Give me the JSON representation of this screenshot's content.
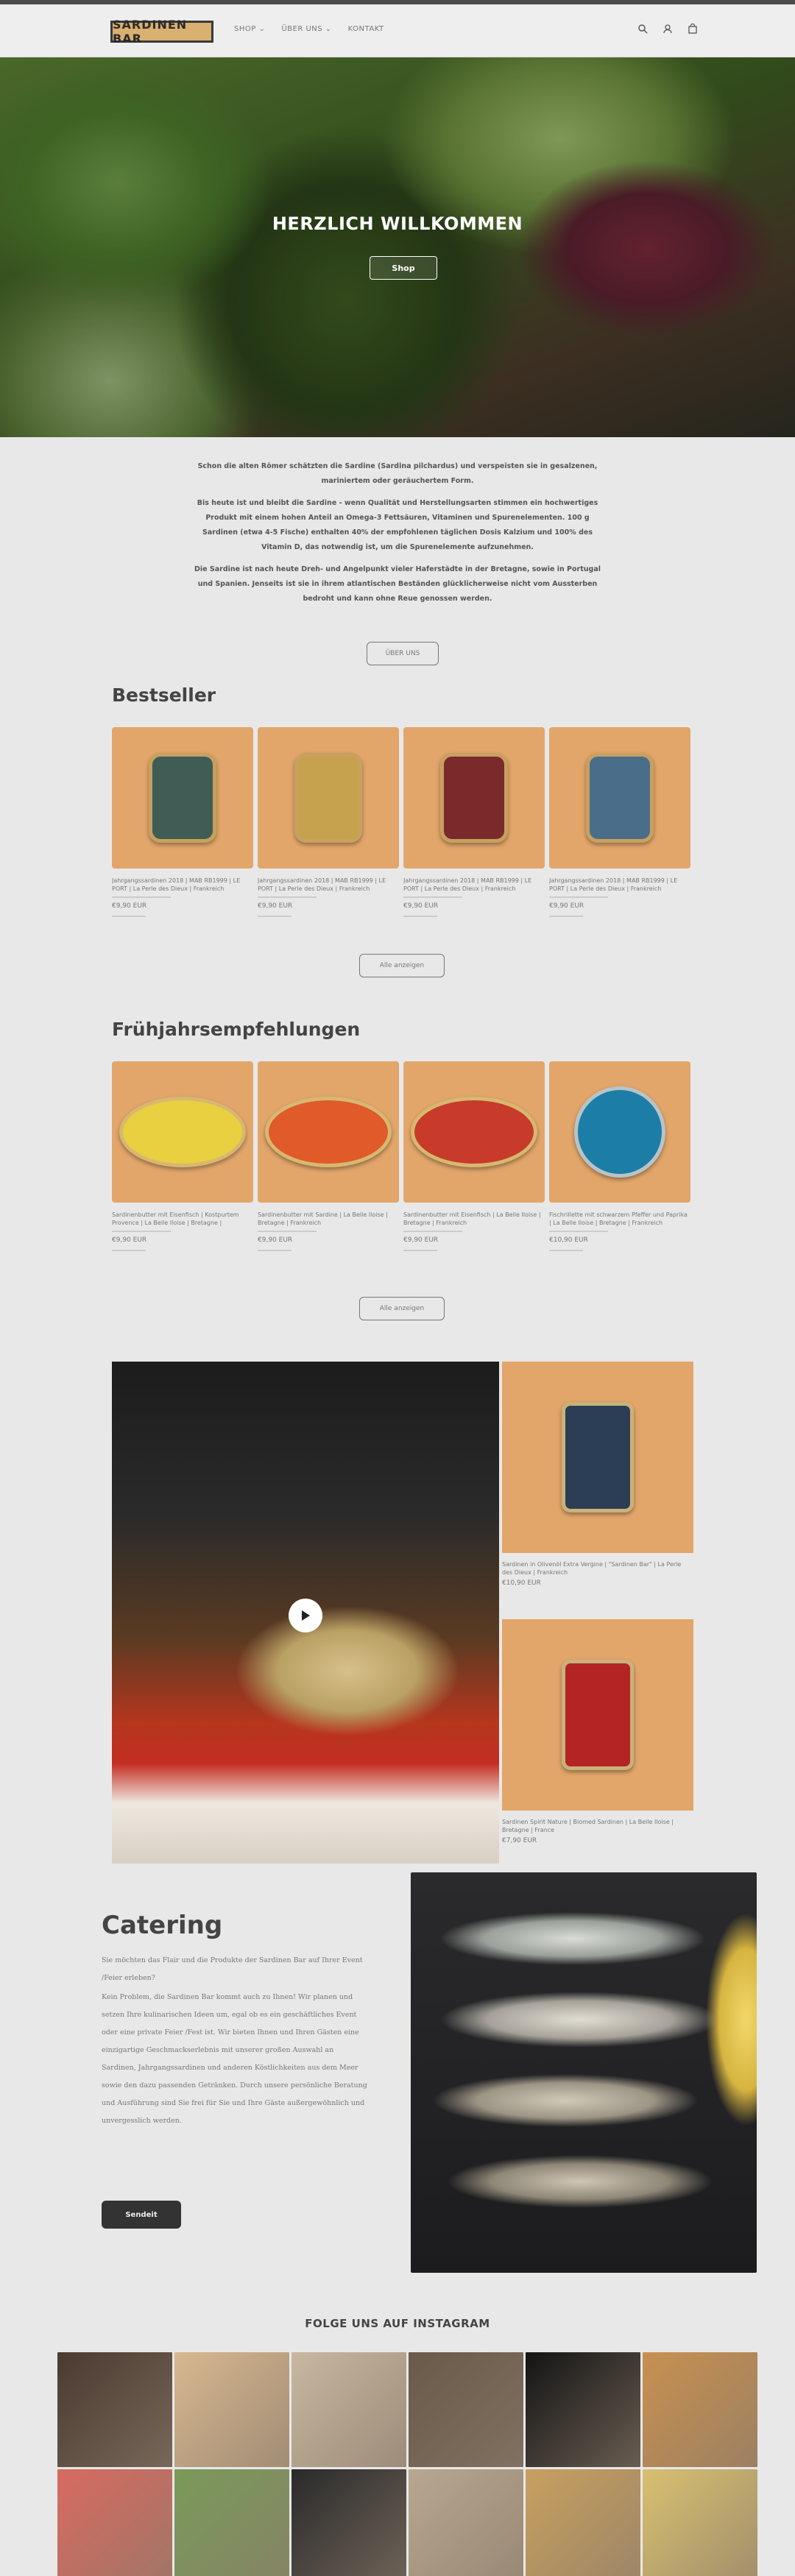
{
  "header": {
    "logo": "SARDINEN BAR",
    "nav": [
      "SHOP ⌄",
      "ÜBER UNS ⌄",
      "KONTAKT"
    ]
  },
  "hero": {
    "title": "HERZLICH WILLKOMMEN",
    "button": "Shop"
  },
  "intro": {
    "paragraphs": [
      "Schon die alten Römer schätzten die Sardine (Sardina pilchardus) und verspeisten sie in gesalzenen, mariniertem oder geräuchertem Form.",
      "Bis heute ist und bleibt die Sardine - wenn Qualität und Herstellungsarten stimmen ein hochwertiges Produkt mit einem hohen Anteil an Omega-3 Fettsäuren, Vitaminen und Spurenelementen. 100 g Sardinen (etwa 4-5 Fische) enthalten 40% der empfohlenen täglichen Dosis Kalzium und 100% des Vitamin D, das notwendig ist, um die Spurenelemente aufzunehmen.",
      "Die Sardine ist nach heute Dreh- und Angelpunkt vieler Haferstädte in der Bretagne, sowie in Portugal und Spanien. Jenseits ist sie in ihrem atlantischen Beständen glücklicherweise nicht vom Aussterben bedroht und kann ohne Reue genossen werden."
    ],
    "button": "ÜBER UNS"
  },
  "bestseller": {
    "title": "Bestseller",
    "products": [
      {
        "name": "Jahrgangssardinen 2018 | MAB RB1999 | LE PORT | La Perle des Dieux | Frankreich",
        "price": "€9,90 EUR",
        "tin_color": "#3f5d55"
      },
      {
        "name": "Jahrgangssardinen 2018 | MAB RB1999 | LE PORT | La Perle des Dieux | Frankreich",
        "price": "€9,90 EUR",
        "tin_color": "#c7a24e"
      },
      {
        "name": "Jahrgangssardinen 2018 | MAB RB1999 | LE PORT | La Perle des Dieux | Frankreich",
        "price": "€9,90 EUR",
        "tin_color": "#7a2a2a"
      },
      {
        "name": "Jahrgangssardinen 2018 | MAB RB1999 | LE PORT | La Perle des Dieux | Frankreich",
        "price": "€9,90 EUR",
        "tin_color": "#4a6d8a"
      }
    ],
    "button": "Alle anzeigen"
  },
  "spring": {
    "title": "Frühjahrsempfehlungen",
    "products": [
      {
        "name": "Sardinenbutter mit Eisenfisch | Kostpurtem Provence | La Belle Iloise | Bretagne | Frankreich",
        "price": "€9,90 EUR",
        "tin_color": "#e8d040"
      },
      {
        "name": "Sardinenbutter mit Sardine | La Belle Iloise | Bretagne | Frankreich",
        "price": "€9,90 EUR",
        "tin_color": "#e05a2a"
      },
      {
        "name": "Sardinenbutter mit Eisenfisch | La Belle Iloise | Bretagne | Frankreich",
        "price": "€9,90 EUR",
        "tin_color": "#c83a2a"
      },
      {
        "name": "Fischrillette mit schwarzem Pfeffer und Paprika | La Belle Iloise | Bretagne | Frankreich",
        "price": "€10,90 EUR",
        "tin_color": "#1c7ea6"
      }
    ],
    "button": "Alle anzeigen"
  },
  "featured": {
    "products": [
      {
        "name": "Sardinen in Olivenöl Extra Vergine | \"Sardinen Bar\" | La Perle des Dieux | Frankreich",
        "price": "€10,90 EUR",
        "tin_color": "#2c3e55"
      },
      {
        "name": "Sardinen Spirit Nature | Biomed Sardinen | La Belle Iloise | Bretagne | France",
        "price": "€7,90 EUR",
        "tin_color": "#b52424"
      }
    ]
  },
  "catering": {
    "title": "Catering",
    "paragraphs": [
      "Sie möchten das Flair und die Produkte der Sardinen Bar auf Ihrer Event /Feier erleben?",
      "Kein Problem, die Sardinen Bar kommt auch zu Ihnen! Wir planen und setzen Ihre kulinarischen Ideen um, egal ob es ein geschäftliches Event oder eine private Feier /Fest ist. Wir bieten Ihnen und Ihren Gästen eine einzigartige Geschmackserlebnis mit unserer großen Auswahl an Sardinen, Jahrgangssardinen und anderen Köstlichkeiten aus dem Meer sowie den dazu passenden Getränken. Durch unsere persönliche Beratung und Ausführung sind Sie frei für Sie und Ihre Gäste außergewöhnlich und unvergesslich werden."
    ],
    "button": "Sendeit"
  },
  "instagram": {
    "title": "FOLGE UNS AUF INSTAGRAM",
    "tiles": [
      "#4a3a30",
      "#d8b890",
      "#c8b8a0",
      "#6a5a4a",
      "#141414",
      "#c89050",
      "#d86a60",
      "#7a9a5a",
      "#2a2a2a",
      "#b8a890",
      "#c8a060",
      "#d8c070"
    ]
  },
  "colors": {
    "accent_card": "#e2a66a",
    "dark_button": "#333333"
  }
}
